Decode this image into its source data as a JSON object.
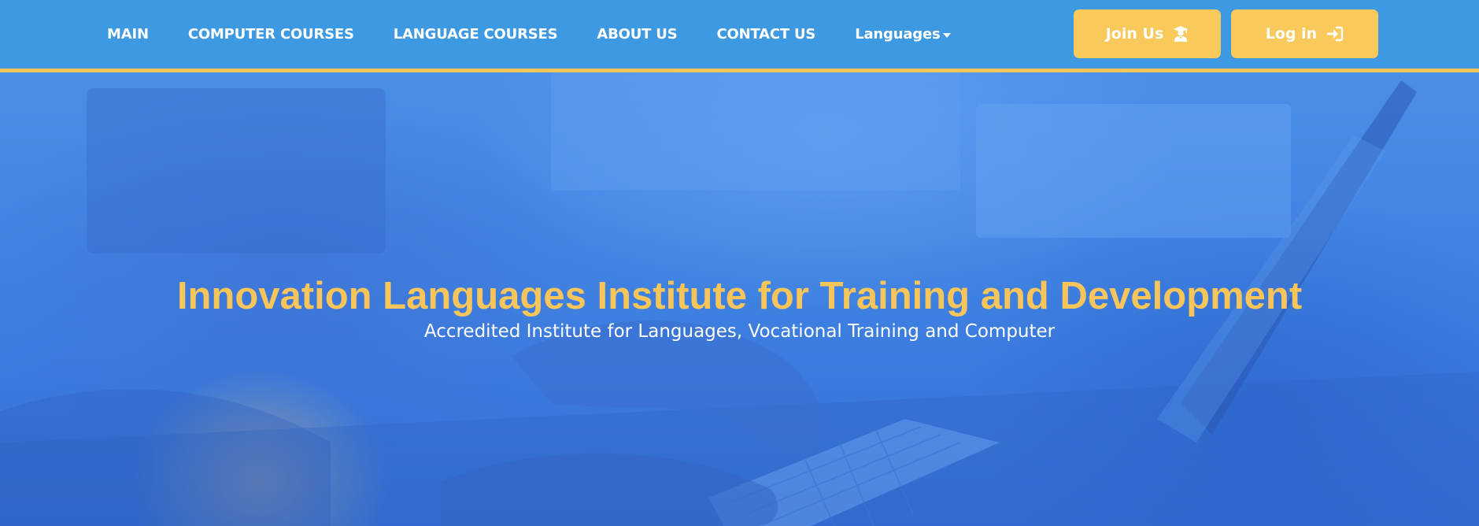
{
  "nav": {
    "items": [
      {
        "label": "MAIN"
      },
      {
        "label": "COMPUTER COURSES"
      },
      {
        "label": "LANGUAGE COURSES"
      },
      {
        "label": "ABOUT US"
      },
      {
        "label": "CONTACT US"
      },
      {
        "label": "Languages"
      }
    ],
    "join_label": "Join Us",
    "login_label": "Log in",
    "join_icon": "graduate-icon",
    "login_icon": "login-icon"
  },
  "hero": {
    "title": "Innovation Languages Institute for Training and Development",
    "subtitle": "Accredited Institute for Languages, Vocational Training and Computer"
  },
  "colors": {
    "navbar": "#3d9ae2",
    "accent": "#f9c95c",
    "hero_title": "#f7c55a",
    "hero_overlay": "#3f8fe0"
  }
}
